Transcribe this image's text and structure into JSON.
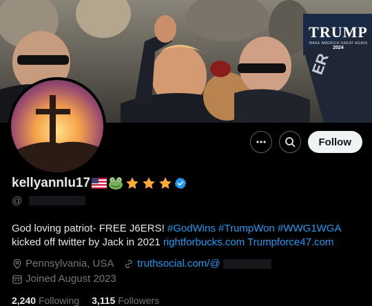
{
  "banner": {
    "sign_title": "TRUMP",
    "sign_subtitle": "MAKE AMERICA GREAT AGAIN",
    "sign_year": "2024",
    "side_sign_text": "ER"
  },
  "profile": {
    "display_name": "kellyannlu17",
    "handle_prefix": "@",
    "badges": [
      "us-flag-icon",
      "frog-icon",
      "star-icon",
      "star-icon",
      "star-icon",
      "verified-badge-icon"
    ],
    "bio": {
      "text1": "God loving patriot- FREE J6ERS! ",
      "hashtag1": "#GodWins",
      "space1": " ",
      "hashtag2": "#TrumpWon",
      "space2": " ",
      "hashtag3": "#WWG1WGA",
      "text2": " kicked off twitter by Jack in 2021 ",
      "link1": "rightforbucks.com",
      "space3": " ",
      "link2": "Trumpforce47.com"
    },
    "location": "Pennsylvania, USA",
    "website": "truthsocial.com/@",
    "joined": "Joined August 2023",
    "following_count": "2,240",
    "following_label": "Following",
    "followers_count": "3,115",
    "followers_label": "Followers"
  },
  "actions": {
    "more_icon": "more-icon",
    "search_icon": "search-icon",
    "follow_label": "Follow"
  },
  "colors": {
    "background": "#000000",
    "text": "#e7e9ea",
    "secondary": "#71767b",
    "link": "#1d9bf0",
    "follow_bg": "#eff3f4"
  }
}
